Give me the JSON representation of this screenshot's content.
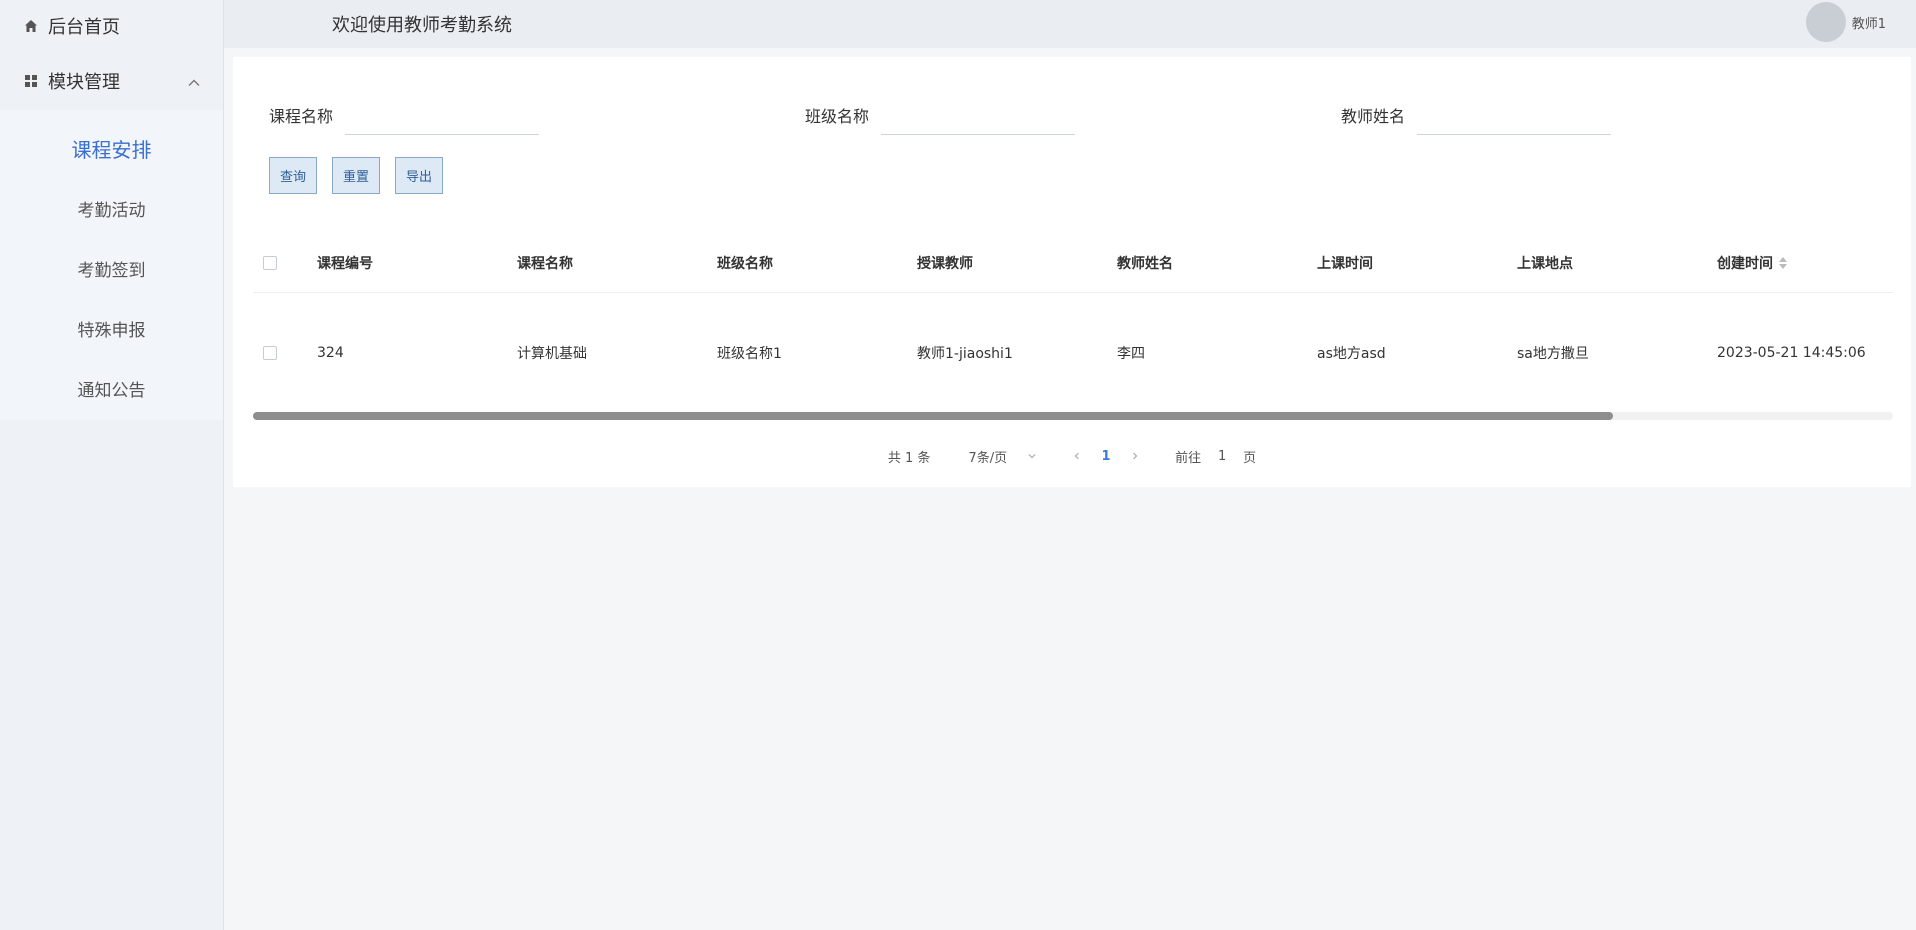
{
  "sidebar": {
    "home": {
      "label": "后台首页",
      "icon": "home-icon"
    },
    "group": {
      "label": "模块管理",
      "icon": "grid-icon",
      "expanded": true
    },
    "items": [
      {
        "label": "课程安排",
        "active": true
      },
      {
        "label": "考勤活动",
        "active": false
      },
      {
        "label": "考勤签到",
        "active": false
      },
      {
        "label": "特殊申报",
        "active": false
      },
      {
        "label": "通知公告",
        "active": false
      }
    ]
  },
  "header": {
    "welcome": "欢迎使用教师考勤系统",
    "username": "教师1"
  },
  "search": {
    "fields": [
      {
        "label": "课程名称",
        "value": ""
      },
      {
        "label": "班级名称",
        "value": ""
      },
      {
        "label": "教师姓名",
        "value": ""
      }
    ],
    "buttons": {
      "query": "查询",
      "reset": "重置",
      "export": "导出"
    }
  },
  "table": {
    "headers": [
      "课程编号",
      "课程名称",
      "班级名称",
      "授课教师",
      "教师姓名",
      "上课时间",
      "上课地点",
      "创建时间"
    ],
    "rows": [
      [
        "324",
        "计算机基础",
        "班级名称1",
        "教师1-jiaoshi1",
        "李四",
        "as地方asd",
        "sa地方撒旦",
        "2023-05-21 14:45:06"
      ]
    ]
  },
  "pagination": {
    "total": "共 1 条",
    "page_size": "7条/页",
    "current": "1",
    "goto_prefix": "前往",
    "goto_value": "1",
    "goto_suffix": "页"
  },
  "colors": {
    "accent": "#3a6fd0",
    "button_bg": "#dde9f5"
  }
}
